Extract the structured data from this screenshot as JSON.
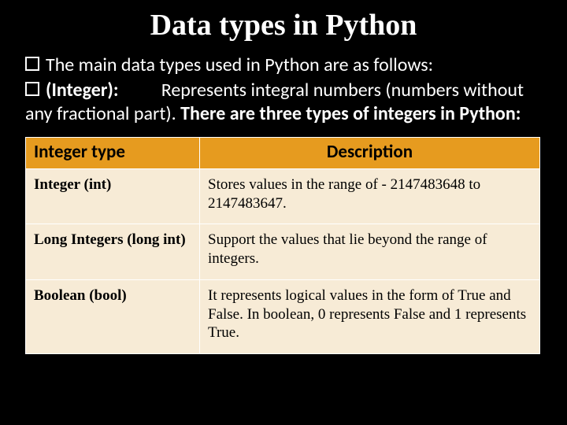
{
  "title": "Data types in Python",
  "bullets": {
    "line1": "The main  data types used in Python are as follows:",
    "line2_label": "(Integer):",
    "line2_rest": "Represents integral numbers (numbers without any fractional part). ",
    "line2_bold": "There are three types of integers in Python:"
  },
  "table": {
    "headers": {
      "type": "Integer type",
      "desc": "Description"
    },
    "rows": [
      {
        "type": "Integer (int)",
        "desc": "Stores values in the range of - 2147483648 to 2147483647."
      },
      {
        "type": "Long Integers (long int)",
        "desc": "Support the values that lie beyond the range of integers."
      },
      {
        "type": "Boolean (bool)",
        "desc": "It represents logical values in the form of True and False. In boolean, 0 represents False and 1 represents True."
      }
    ]
  }
}
